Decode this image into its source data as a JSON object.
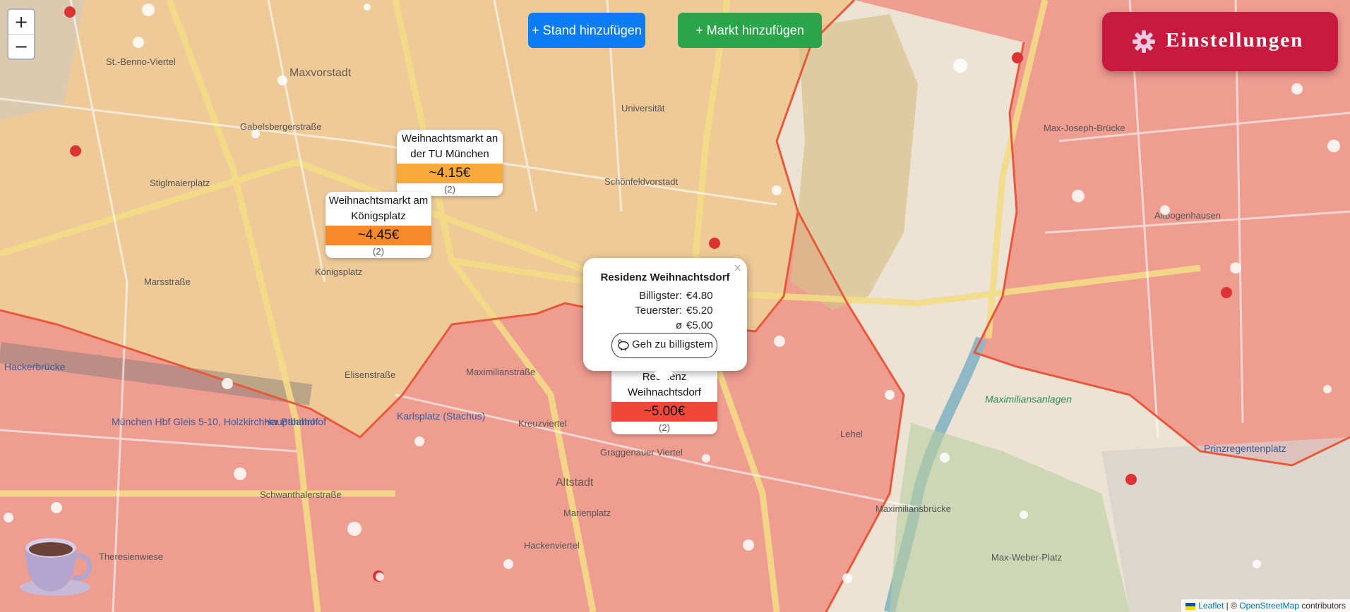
{
  "map": {
    "zoom_in": "+",
    "zoom_out": "−",
    "place_labels": [
      "St.-Benno-Viertel",
      "Maxvorstadt",
      "Universität",
      "Schönfeldvorstadt",
      "Königsplatz",
      "Stiglmaierplatz",
      "Hackerbrücke",
      "Altstadt",
      "Kreuzviertel",
      "Graggenauer Viertel",
      "Lehel",
      "Marienplatz",
      "Hackenviertel",
      "Altbogenhausen",
      "Maximiliansanlagen",
      "Prinzregentenplatz",
      "Max-Joseph-Brücke",
      "Maximiliansbrücke",
      "Max-Weber-Platz",
      "Karlsplatz (Stachus)",
      "Hauptbahnhof",
      "München Hbf Gleis 5-10, Holzkirchner Bahnhof",
      "Maximilianstraße",
      "Schwanthalerstraße",
      "Elisenstraße",
      "Marsstraße",
      "Gabelsbergerstraße",
      "Theresienwiese"
    ]
  },
  "buttons": {
    "add_stand": "+ Stand hinzufügen",
    "add_market": "+ Markt hinzufügen",
    "settings": "Einstellungen"
  },
  "markets": [
    {
      "name": "Weihnachtsmarkt an der TU München",
      "price": "~4.15€",
      "count": "(2)",
      "color": "#f9a93a"
    },
    {
      "name": "Weihnachtsmarkt am Königsplatz",
      "price": "~4.45€",
      "count": "(2)",
      "color": "#f6892c"
    },
    {
      "name": "Residenz Weihnachtsdorf",
      "price": "~5.00€",
      "count": "(2)",
      "color": "#f0473a"
    }
  ],
  "popup": {
    "title": "Residenz Weihnachtsdorf",
    "cheapest_label": "Billigster:",
    "cheapest_value": "€4.80",
    "expensive_label": "Teuerster:",
    "expensive_value": "€5.20",
    "avg_label": "ø",
    "avg_value": "€5.00",
    "go_button": "Geh zu billigstem",
    "close": "×"
  },
  "attribution": {
    "leaflet": "Leaflet",
    "separator": " | © ",
    "osm": "OpenStreetMap",
    "suffix": " contributors"
  },
  "colors": {
    "expensive_zone": "#f08a82",
    "mid_zone": "#f2c98a",
    "accent_red": "#c8193e",
    "blue": "#0d7cf2",
    "green": "#2aa54a"
  }
}
